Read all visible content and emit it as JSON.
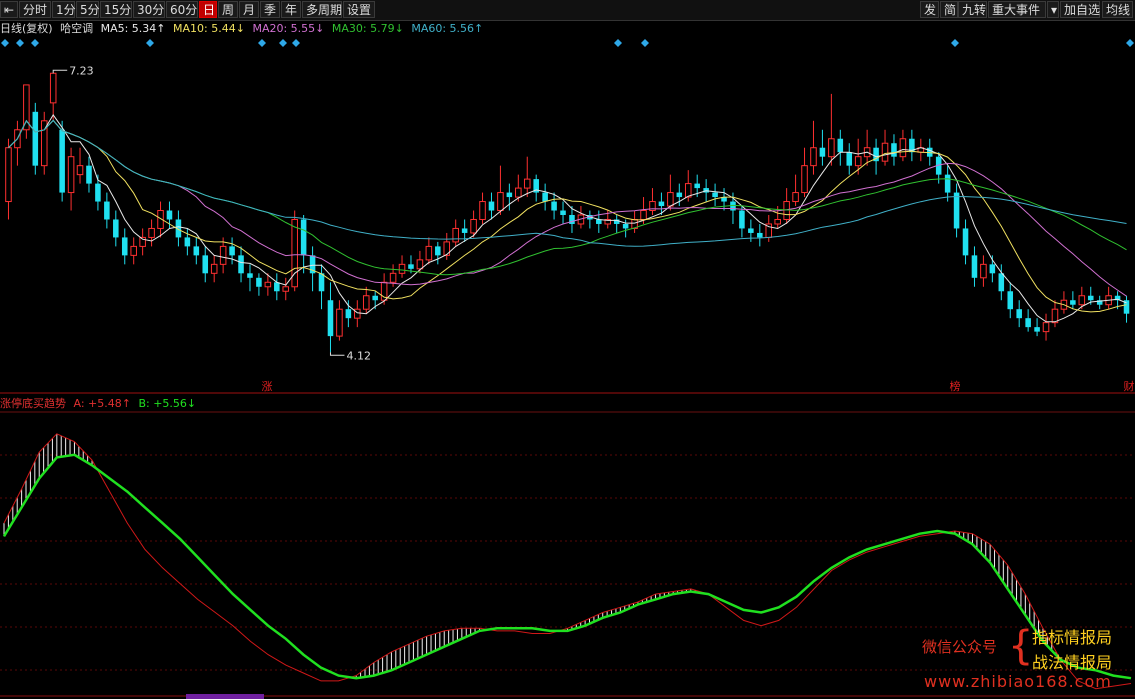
{
  "toolbar": {
    "left": [
      {
        "label": "分时",
        "active": false
      },
      {
        "label": "1分",
        "active": false
      },
      {
        "label": "5分",
        "active": false
      },
      {
        "label": "15分",
        "active": false
      },
      {
        "label": "30分",
        "active": false
      },
      {
        "label": "60分",
        "active": false
      },
      {
        "label": "日",
        "active": true
      },
      {
        "label": "周",
        "active": false
      },
      {
        "label": "月",
        "active": false
      },
      {
        "label": "季",
        "active": false
      },
      {
        "label": "年",
        "active": false
      },
      {
        "label": "多周期",
        "active": false
      },
      {
        "label": "设置",
        "active": false
      }
    ],
    "right": [
      {
        "label": "发"
      },
      {
        "label": "简"
      },
      {
        "label": "九转"
      },
      {
        "label": "重大事件"
      },
      {
        "label": "加自选"
      },
      {
        "label": "均线"
      }
    ]
  },
  "info": {
    "period": "日线(复权)",
    "type": "哈空调",
    "ma5": {
      "label": "MA5: 5.34↑",
      "color": "#e8e8e8"
    },
    "ma10": {
      "label": "MA10: 5.44↓",
      "color": "#f0e060"
    },
    "ma20": {
      "label": "MA20: 5.55↓",
      "color": "#d070d0"
    },
    "ma30": {
      "label": "MA30: 5.79↓",
      "color": "#30c030"
    },
    "ma60": {
      "label": "MA60: 5.56↑",
      "color": "#40b0c8"
    }
  },
  "indicator": {
    "name": "涨停底买趋势",
    "a": "A: +5.48↑",
    "b": "B: +5.56↓"
  },
  "markers": {
    "zhang": "涨",
    "bang": "榜",
    "cai": "财"
  },
  "watermark": {
    "line1": "微信公众号",
    "line2a": "指标情报局",
    "line2b": "战法情报局",
    "url": "www.zhibiao168.com"
  },
  "chart_data": [
    {
      "type": "candlestick",
      "title": "日线(复权)",
      "ylim": [
        3.9,
        7.4
      ],
      "max_label": "7.23",
      "min_label": "4.12",
      "colors": {
        "up": "#ff3030",
        "down": "#20e0f0"
      },
      "candles": [
        [
          5.8,
          6.4,
          6.5,
          5.6
        ],
        [
          6.4,
          6.6,
          6.7,
          6.2
        ],
        [
          6.6,
          7.1,
          7.1,
          6.5
        ],
        [
          6.8,
          6.2,
          6.9,
          6.1
        ],
        [
          6.2,
          6.7,
          6.8,
          6.1
        ],
        [
          6.9,
          7.23,
          7.23,
          6.7
        ],
        [
          6.6,
          5.9,
          6.7,
          5.8
        ],
        [
          5.9,
          6.3,
          6.4,
          5.7
        ],
        [
          6.1,
          6.2,
          6.4,
          6.0
        ],
        [
          6.2,
          6.0,
          6.3,
          5.9
        ],
        [
          6.0,
          5.8,
          6.1,
          5.7
        ],
        [
          5.8,
          5.6,
          5.9,
          5.5
        ],
        [
          5.6,
          5.4,
          5.7,
          5.3
        ],
        [
          5.4,
          5.2,
          5.5,
          5.1
        ],
        [
          5.2,
          5.3,
          5.4,
          5.1
        ],
        [
          5.3,
          5.4,
          5.5,
          5.2
        ],
        [
          5.4,
          5.5,
          5.6,
          5.3
        ],
        [
          5.5,
          5.7,
          5.8,
          5.4
        ],
        [
          5.7,
          5.6,
          5.8,
          5.5
        ],
        [
          5.6,
          5.4,
          5.7,
          5.3
        ],
        [
          5.4,
          5.3,
          5.5,
          5.2
        ],
        [
          5.3,
          5.2,
          5.4,
          5.1
        ],
        [
          5.2,
          5.0,
          5.3,
          4.9
        ],
        [
          5.0,
          5.1,
          5.2,
          4.9
        ],
        [
          5.1,
          5.3,
          5.4,
          5.0
        ],
        [
          5.3,
          5.2,
          5.4,
          5.1
        ],
        [
          5.2,
          5.0,
          5.3,
          4.9
        ],
        [
          5.0,
          4.95,
          5.1,
          4.8
        ],
        [
          4.95,
          4.85,
          5.0,
          4.75
        ],
        [
          4.85,
          4.9,
          5.0,
          4.75
        ],
        [
          4.9,
          4.8,
          5.0,
          4.7
        ],
        [
          4.8,
          4.85,
          4.95,
          4.7
        ],
        [
          4.85,
          5.6,
          5.7,
          4.8
        ],
        [
          5.6,
          5.2,
          5.65,
          5.0
        ],
        [
          5.2,
          5.0,
          5.3,
          4.8
        ],
        [
          5.0,
          4.8,
          5.1,
          4.6
        ],
        [
          4.7,
          4.3,
          4.9,
          4.12
        ],
        [
          4.3,
          4.6,
          4.7,
          4.25
        ],
        [
          4.6,
          4.5,
          4.7,
          4.4
        ],
        [
          4.5,
          4.6,
          4.7,
          4.4
        ],
        [
          4.6,
          4.75,
          4.85,
          4.55
        ],
        [
          4.75,
          4.7,
          4.8,
          4.6
        ],
        [
          4.7,
          4.9,
          5.0,
          4.65
        ],
        [
          4.9,
          5.0,
          5.1,
          4.85
        ],
        [
          5.0,
          5.1,
          5.2,
          4.95
        ],
        [
          5.1,
          5.05,
          5.2,
          5.0
        ],
        [
          5.05,
          5.15,
          5.25,
          5.0
        ],
        [
          5.15,
          5.3,
          5.4,
          5.1
        ],
        [
          5.3,
          5.2,
          5.35,
          5.1
        ],
        [
          5.2,
          5.35,
          5.45,
          5.15
        ],
        [
          5.35,
          5.5,
          5.6,
          5.3
        ],
        [
          5.5,
          5.45,
          5.6,
          5.35
        ],
        [
          5.45,
          5.6,
          5.7,
          5.4
        ],
        [
          5.6,
          5.8,
          5.9,
          5.55
        ],
        [
          5.8,
          5.7,
          5.9,
          5.6
        ],
        [
          5.7,
          5.9,
          6.2,
          5.65
        ],
        [
          5.9,
          5.85,
          6.0,
          5.7
        ],
        [
          5.85,
          5.95,
          6.1,
          5.8
        ],
        [
          5.95,
          6.05,
          6.3,
          5.85
        ],
        [
          6.05,
          5.9,
          6.1,
          5.8
        ],
        [
          5.9,
          5.8,
          6.0,
          5.7
        ],
        [
          5.8,
          5.7,
          5.9,
          5.6
        ],
        [
          5.7,
          5.65,
          5.8,
          5.55
        ],
        [
          5.65,
          5.55,
          5.75,
          5.45
        ],
        [
          5.55,
          5.65,
          5.75,
          5.5
        ],
        [
          5.65,
          5.6,
          5.7,
          5.5
        ],
        [
          5.6,
          5.55,
          5.7,
          5.45
        ],
        [
          5.55,
          5.6,
          5.7,
          5.5
        ],
        [
          5.6,
          5.55,
          5.65,
          5.45
        ],
        [
          5.55,
          5.5,
          5.6,
          5.4
        ],
        [
          5.5,
          5.6,
          5.7,
          5.45
        ],
        [
          5.6,
          5.7,
          5.85,
          5.55
        ],
        [
          5.7,
          5.8,
          5.95,
          5.65
        ],
        [
          5.8,
          5.75,
          5.9,
          5.65
        ],
        [
          5.75,
          5.9,
          6.1,
          5.7
        ],
        [
          5.9,
          5.85,
          6.0,
          5.75
        ],
        [
          5.85,
          6.0,
          6.15,
          5.8
        ],
        [
          6.0,
          5.95,
          6.1,
          5.85
        ],
        [
          5.95,
          5.9,
          6.05,
          5.8
        ],
        [
          5.9,
          5.85,
          6.0,
          5.75
        ],
        [
          5.85,
          5.8,
          5.95,
          5.7
        ],
        [
          5.8,
          5.7,
          5.9,
          5.55
        ],
        [
          5.7,
          5.5,
          5.75,
          5.4
        ],
        [
          5.5,
          5.45,
          5.6,
          5.35
        ],
        [
          5.45,
          5.4,
          5.55,
          5.3
        ],
        [
          5.4,
          5.55,
          5.65,
          5.35
        ],
        [
          5.55,
          5.6,
          5.75,
          5.5
        ],
        [
          5.6,
          5.8,
          5.95,
          5.55
        ],
        [
          5.8,
          5.9,
          6.1,
          5.75
        ],
        [
          5.9,
          6.2,
          6.4,
          5.85
        ],
        [
          6.2,
          6.4,
          6.7,
          6.1
        ],
        [
          6.4,
          6.3,
          6.6,
          6.2
        ],
        [
          6.3,
          6.5,
          7.0,
          6.2
        ],
        [
          6.5,
          6.35,
          6.6,
          6.2
        ],
        [
          6.35,
          6.2,
          6.45,
          6.1
        ],
        [
          6.2,
          6.3,
          6.5,
          6.1
        ],
        [
          6.3,
          6.4,
          6.6,
          6.2
        ],
        [
          6.4,
          6.25,
          6.5,
          6.1
        ],
        [
          6.25,
          6.45,
          6.6,
          6.2
        ],
        [
          6.45,
          6.3,
          6.55,
          6.2
        ],
        [
          6.3,
          6.5,
          6.6,
          6.25
        ],
        [
          6.5,
          6.35,
          6.6,
          6.25
        ],
        [
          6.35,
          6.4,
          6.5,
          6.25
        ],
        [
          6.4,
          6.3,
          6.5,
          6.2
        ],
        [
          6.3,
          6.1,
          6.35,
          6.0
        ],
        [
          6.1,
          5.9,
          6.2,
          5.8
        ],
        [
          5.9,
          5.5,
          6.0,
          5.4
        ],
        [
          5.5,
          5.2,
          5.6,
          5.1
        ],
        [
          5.2,
          4.95,
          5.3,
          4.85
        ],
        [
          4.95,
          5.1,
          5.2,
          4.85
        ],
        [
          5.1,
          5.0,
          5.2,
          4.9
        ],
        [
          5.0,
          4.8,
          5.1,
          4.7
        ],
        [
          4.8,
          4.6,
          4.9,
          4.5
        ],
        [
          4.6,
          4.5,
          4.7,
          4.4
        ],
        [
          4.5,
          4.4,
          4.6,
          4.35
        ],
        [
          4.4,
          4.35,
          4.5,
          4.3
        ],
        [
          4.35,
          4.45,
          4.55,
          4.25
        ],
        [
          4.45,
          4.6,
          4.7,
          4.4
        ],
        [
          4.6,
          4.7,
          4.8,
          4.55
        ],
        [
          4.7,
          4.65,
          4.8,
          4.6
        ],
        [
          4.65,
          4.75,
          4.85,
          4.6
        ],
        [
          4.75,
          4.7,
          4.85,
          4.65
        ],
        [
          4.7,
          4.65,
          4.75,
          4.6
        ],
        [
          4.65,
          4.75,
          4.85,
          4.6
        ],
        [
          4.75,
          4.7,
          4.8,
          4.6
        ],
        [
          4.7,
          4.55,
          4.75,
          4.45
        ]
      ],
      "ma_colors": {
        "MA5": "#e8e8e8",
        "MA10": "#f0e060",
        "MA20": "#d070d0",
        "MA30": "#30c030",
        "MA60": "#40b0c8"
      }
    },
    {
      "type": "line",
      "title": "涨停底买趋势",
      "ylim": [
        -0.5,
        10
      ],
      "series": [
        {
          "name": "A",
          "color": "#d01818",
          "values": [
            6.0,
            7.3,
            8.7,
            9.4,
            9.1,
            8.4,
            7.2,
            6.0,
            5.0,
            4.3,
            3.7,
            3.1,
            2.6,
            2.1,
            1.5,
            1.0,
            0.6,
            0.3,
            0.0,
            0.0,
            0.2,
            0.7,
            1.1,
            1.4,
            1.7,
            1.9,
            2.0,
            2.0,
            1.9,
            1.9,
            1.8,
            1.8,
            2.0,
            2.3,
            2.6,
            2.8,
            3.0,
            3.3,
            3.4,
            3.5,
            3.3,
            2.8,
            2.3,
            2.1,
            2.3,
            2.8,
            3.5,
            4.2,
            4.6,
            4.9,
            5.1,
            5.3,
            5.5,
            5.6,
            5.7,
            5.6,
            5.2,
            4.4,
            3.3,
            2.0,
            0.8,
            0.0,
            -0.3,
            -0.2,
            -0.1
          ]
        },
        {
          "name": "B",
          "color": "#20e020",
          "values": [
            5.5,
            6.6,
            7.7,
            8.5,
            8.6,
            8.2,
            7.7,
            7.2,
            6.6,
            6.0,
            5.4,
            4.7,
            4.0,
            3.3,
            2.7,
            2.1,
            1.6,
            1.0,
            0.5,
            0.2,
            0.1,
            0.2,
            0.4,
            0.7,
            1.0,
            1.3,
            1.6,
            1.9,
            2.0,
            2.0,
            2.0,
            1.9,
            1.9,
            2.1,
            2.4,
            2.6,
            2.9,
            3.1,
            3.3,
            3.4,
            3.3,
            3.0,
            2.7,
            2.6,
            2.8,
            3.2,
            3.8,
            4.3,
            4.7,
            5.0,
            5.2,
            5.4,
            5.6,
            5.7,
            5.6,
            5.2,
            4.5,
            3.5,
            2.5,
            1.5,
            0.8,
            0.5,
            0.4,
            0.2,
            0.1
          ]
        }
      ]
    }
  ]
}
